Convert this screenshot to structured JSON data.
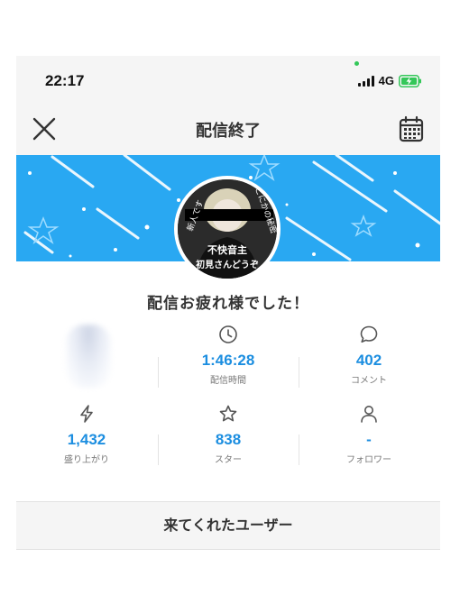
{
  "status_bar": {
    "time": "22:17",
    "network": "4G"
  },
  "header": {
    "title": "配信終了"
  },
  "avatar": {
    "text_lines": [
      "不快音主",
      "初見さんどうぞ"
    ],
    "side_text_left": "新人です",
    "side_text_right": "ごにかの秘密"
  },
  "message": "配信お疲れ様でした！",
  "stats": {
    "duration": {
      "value": "1:46:28",
      "label": "配信時間"
    },
    "comments": {
      "value": "402",
      "label": "コメント"
    },
    "hype": {
      "value": "1,432",
      "label": "盛り上がり"
    },
    "stars": {
      "value": "838",
      "label": "スター"
    },
    "followers": {
      "value": "-",
      "label": "フォロワー"
    }
  },
  "visitors_button": {
    "label": "来てくれたユーザー"
  },
  "colors": {
    "banner": "#29a8f2",
    "accent": "#1c8ee0",
    "battery": "#34c759"
  }
}
